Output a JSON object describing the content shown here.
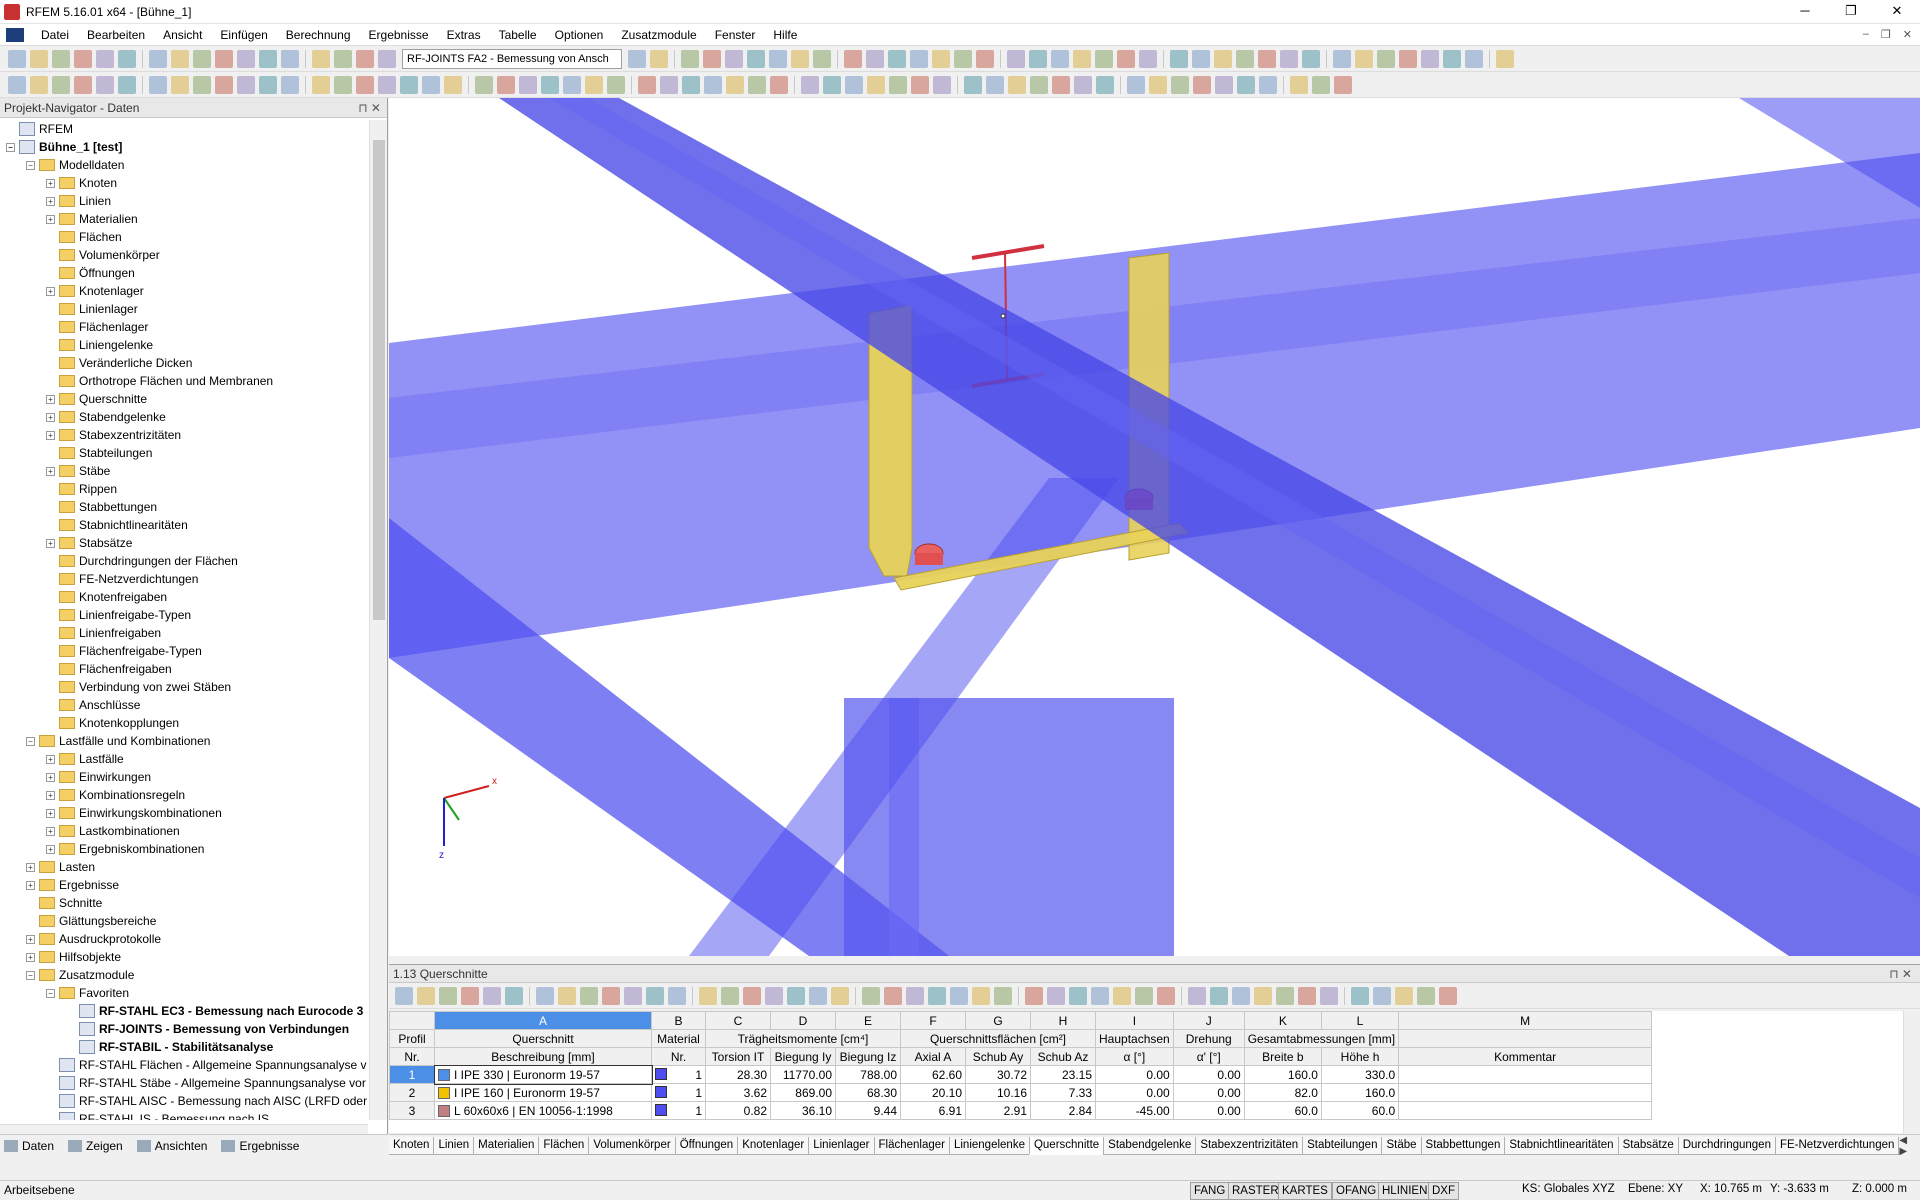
{
  "window": {
    "title": "RFEM 5.16.01 x64 - [Bühne_1]"
  },
  "menu": [
    "Datei",
    "Bearbeiten",
    "Ansicht",
    "Einfügen",
    "Berechnung",
    "Ergebnisse",
    "Extras",
    "Tabelle",
    "Optionen",
    "Zusatzmodule",
    "Fenster",
    "Hilfe"
  ],
  "toolbar": {
    "module_combo": "RF-JOINTS FA2 - Bemessung von Ansch"
  },
  "navigator": {
    "title": "Projekt-Navigator - Daten",
    "tree": [
      {
        "label": "RFEM",
        "level": 0,
        "exp": "",
        "icon": "mod"
      },
      {
        "label": "Bühne_1 [test]",
        "level": 0,
        "exp": "-",
        "icon": "mod",
        "bold": true
      },
      {
        "label": "Modelldaten",
        "level": 1,
        "exp": "-",
        "icon": "fold"
      },
      {
        "label": "Knoten",
        "level": 2,
        "exp": "+",
        "icon": "fold"
      },
      {
        "label": "Linien",
        "level": 2,
        "exp": "+",
        "icon": "fold"
      },
      {
        "label": "Materialien",
        "level": 2,
        "exp": "+",
        "icon": "fold"
      },
      {
        "label": "Flächen",
        "level": 2,
        "exp": "",
        "icon": "fold"
      },
      {
        "label": "Volumenkörper",
        "level": 2,
        "exp": "",
        "icon": "fold"
      },
      {
        "label": "Öffnungen",
        "level": 2,
        "exp": "",
        "icon": "fold"
      },
      {
        "label": "Knotenlager",
        "level": 2,
        "exp": "+",
        "icon": "fold"
      },
      {
        "label": "Linienlager",
        "level": 2,
        "exp": "",
        "icon": "fold"
      },
      {
        "label": "Flächenlager",
        "level": 2,
        "exp": "",
        "icon": "fold"
      },
      {
        "label": "Liniengelenke",
        "level": 2,
        "exp": "",
        "icon": "fold"
      },
      {
        "label": "Veränderliche Dicken",
        "level": 2,
        "exp": "",
        "icon": "fold"
      },
      {
        "label": "Orthotrope Flächen und Membranen",
        "level": 2,
        "exp": "",
        "icon": "fold"
      },
      {
        "label": "Querschnitte",
        "level": 2,
        "exp": "+",
        "icon": "fold"
      },
      {
        "label": "Stabendgelenke",
        "level": 2,
        "exp": "+",
        "icon": "fold"
      },
      {
        "label": "Stabexzentrizitäten",
        "level": 2,
        "exp": "+",
        "icon": "fold"
      },
      {
        "label": "Stabteilungen",
        "level": 2,
        "exp": "",
        "icon": "fold"
      },
      {
        "label": "Stäbe",
        "level": 2,
        "exp": "+",
        "icon": "fold"
      },
      {
        "label": "Rippen",
        "level": 2,
        "exp": "",
        "icon": "fold"
      },
      {
        "label": "Stabbettungen",
        "level": 2,
        "exp": "",
        "icon": "fold"
      },
      {
        "label": "Stabnichtlinearitäten",
        "level": 2,
        "exp": "",
        "icon": "fold"
      },
      {
        "label": "Stabsätze",
        "level": 2,
        "exp": "+",
        "icon": "fold"
      },
      {
        "label": "Durchdringungen der Flächen",
        "level": 2,
        "exp": "",
        "icon": "fold"
      },
      {
        "label": "FE-Netzverdichtungen",
        "level": 2,
        "exp": "",
        "icon": "fold"
      },
      {
        "label": "Knotenfreigaben",
        "level": 2,
        "exp": "",
        "icon": "fold"
      },
      {
        "label": "Linienfreigabe-Typen",
        "level": 2,
        "exp": "",
        "icon": "fold"
      },
      {
        "label": "Linienfreigaben",
        "level": 2,
        "exp": "",
        "icon": "fold"
      },
      {
        "label": "Flächenfreigabe-Typen",
        "level": 2,
        "exp": "",
        "icon": "fold"
      },
      {
        "label": "Flächenfreigaben",
        "level": 2,
        "exp": "",
        "icon": "fold"
      },
      {
        "label": "Verbindung von zwei Stäben",
        "level": 2,
        "exp": "",
        "icon": "fold"
      },
      {
        "label": "Anschlüsse",
        "level": 2,
        "exp": "",
        "icon": "fold"
      },
      {
        "label": "Knotenkopplungen",
        "level": 2,
        "exp": "",
        "icon": "fold"
      },
      {
        "label": "Lastfälle und Kombinationen",
        "level": 1,
        "exp": "-",
        "icon": "fold"
      },
      {
        "label": "Lastfälle",
        "level": 2,
        "exp": "+",
        "icon": "fold"
      },
      {
        "label": "Einwirkungen",
        "level": 2,
        "exp": "+",
        "icon": "fold"
      },
      {
        "label": "Kombinationsregeln",
        "level": 2,
        "exp": "+",
        "icon": "fold"
      },
      {
        "label": "Einwirkungskombinationen",
        "level": 2,
        "exp": "+",
        "icon": "fold"
      },
      {
        "label": "Lastkombinationen",
        "level": 2,
        "exp": "+",
        "icon": "fold"
      },
      {
        "label": "Ergebniskombinationen",
        "level": 2,
        "exp": "+",
        "icon": "fold"
      },
      {
        "label": "Lasten",
        "level": 1,
        "exp": "+",
        "icon": "fold"
      },
      {
        "label": "Ergebnisse",
        "level": 1,
        "exp": "+",
        "icon": "fold"
      },
      {
        "label": "Schnitte",
        "level": 1,
        "exp": "",
        "icon": "fold"
      },
      {
        "label": "Glättungsbereiche",
        "level": 1,
        "exp": "",
        "icon": "fold"
      },
      {
        "label": "Ausdruckprotokolle",
        "level": 1,
        "exp": "+",
        "icon": "fold"
      },
      {
        "label": "Hilfsobjekte",
        "level": 1,
        "exp": "+",
        "icon": "fold"
      },
      {
        "label": "Zusatzmodule",
        "level": 1,
        "exp": "-",
        "icon": "fold"
      },
      {
        "label": "Favoriten",
        "level": 2,
        "exp": "-",
        "icon": "fold"
      },
      {
        "label": "RF-STAHL EC3 - Bemessung nach Eurocode 3",
        "level": 3,
        "exp": "",
        "icon": "mod",
        "bold": true
      },
      {
        "label": "RF-JOINTS - Bemessung von Verbindungen",
        "level": 3,
        "exp": "",
        "icon": "mod",
        "bold": true
      },
      {
        "label": "RF-STABIL - Stabilitätsanalyse",
        "level": 3,
        "exp": "",
        "icon": "mod",
        "bold": true
      },
      {
        "label": "RF-STAHL Flächen - Allgemeine Spannungsanalyse v",
        "level": 2,
        "exp": "",
        "icon": "mod"
      },
      {
        "label": "RF-STAHL Stäbe - Allgemeine Spannungsanalyse vor",
        "level": 2,
        "exp": "",
        "icon": "mod"
      },
      {
        "label": "RF-STAHL AISC - Bemessung nach AISC (LRFD oder A",
        "level": 2,
        "exp": "",
        "icon": "mod"
      },
      {
        "label": "RF-STAHL IS - Bemessung nach IS",
        "level": 2,
        "exp": "",
        "icon": "mod"
      }
    ],
    "tabs": [
      "Daten",
      "Zeigen",
      "Ansichten",
      "Ergebnisse"
    ]
  },
  "viewport": {
    "axis_x": "x",
    "axis_z": "z"
  },
  "table": {
    "title": "1.13 Querschnitte",
    "letters": [
      "A",
      "B",
      "C",
      "D",
      "E",
      "F",
      "G",
      "H",
      "I",
      "J",
      "K",
      "L",
      "M"
    ],
    "group_headers": {
      "profil": "Profil",
      "A": "Querschnitt",
      "B": "Material",
      "CDE": "Trägheitsmomente [cm⁴]",
      "FGH": "Querschnittsflächen [cm²]",
      "I": "Hauptachsen",
      "J": "Drehung",
      "KL": "Gesamtabmessungen [mm]",
      "M": ""
    },
    "sub_headers": {
      "profil": "Nr.",
      "A": "Beschreibung [mm]",
      "B": "Nr.",
      "C": "Torsion IT",
      "D": "Biegung Iy",
      "E": "Biegung Iz",
      "F": "Axial A",
      "G": "Schub Ay",
      "H": "Schub Az",
      "I": "α [°]",
      "J": "α' [°]",
      "K": "Breite b",
      "L": "Höhe h",
      "M": "Kommentar"
    },
    "rows": [
      {
        "nr": "1",
        "color": "#4f8ee8",
        "desc": "I IPE 330 | Euronorm 19-57",
        "mat": "1",
        "it": "28.30",
        "iy": "11770.00",
        "iz": "788.00",
        "a": "62.60",
        "ay": "30.72",
        "az": "23.15",
        "alpha": "0.00",
        "alpha2": "0.00",
        "b": "160.0",
        "h": "330.0",
        "comment": ""
      },
      {
        "nr": "2",
        "color": "#f2c200",
        "desc": "I IPE 160 | Euronorm 19-57",
        "mat": "1",
        "it": "3.62",
        "iy": "869.00",
        "iz": "68.30",
        "a": "20.10",
        "ay": "10.16",
        "az": "7.33",
        "alpha": "0.00",
        "alpha2": "0.00",
        "b": "82.0",
        "h": "160.0",
        "comment": ""
      },
      {
        "nr": "3",
        "color": "#c08080",
        "desc": "L 60x60x6 | EN 10056-1:1998",
        "mat": "1",
        "it": "0.82",
        "iy": "36.10",
        "iz": "9.44",
        "a": "6.91",
        "ay": "2.91",
        "az": "2.84",
        "alpha": "-45.00",
        "alpha2": "0.00",
        "b": "60.0",
        "h": "60.0",
        "comment": ""
      }
    ],
    "sheet_tabs": [
      "Knoten",
      "Linien",
      "Materialien",
      "Flächen",
      "Volumenkörper",
      "Öffnungen",
      "Knotenlager",
      "Linienlager",
      "Flächenlager",
      "Liniengelenke",
      "Querschnitte",
      "Stabendgelenke",
      "Stabexzentrizitäten",
      "Stabteilungen",
      "Stäbe",
      "Stabbettungen",
      "Stabnichtlinearitäten",
      "Stabsätze",
      "Durchdringungen",
      "FE-Netzverdichtungen"
    ],
    "active_tab": "Querschnitte"
  },
  "status": {
    "message": "Arbeitsebene",
    "buttons": [
      "FANG",
      "RASTER",
      "KARTES",
      "OFANG",
      "HLINIEN",
      "DXF"
    ],
    "ks": "KS: Globales XYZ",
    "ebene": "Ebene: XY",
    "x": "X: 10.765 m",
    "y": "Y: -3.633 m",
    "z": "Z: 0.000 m"
  }
}
